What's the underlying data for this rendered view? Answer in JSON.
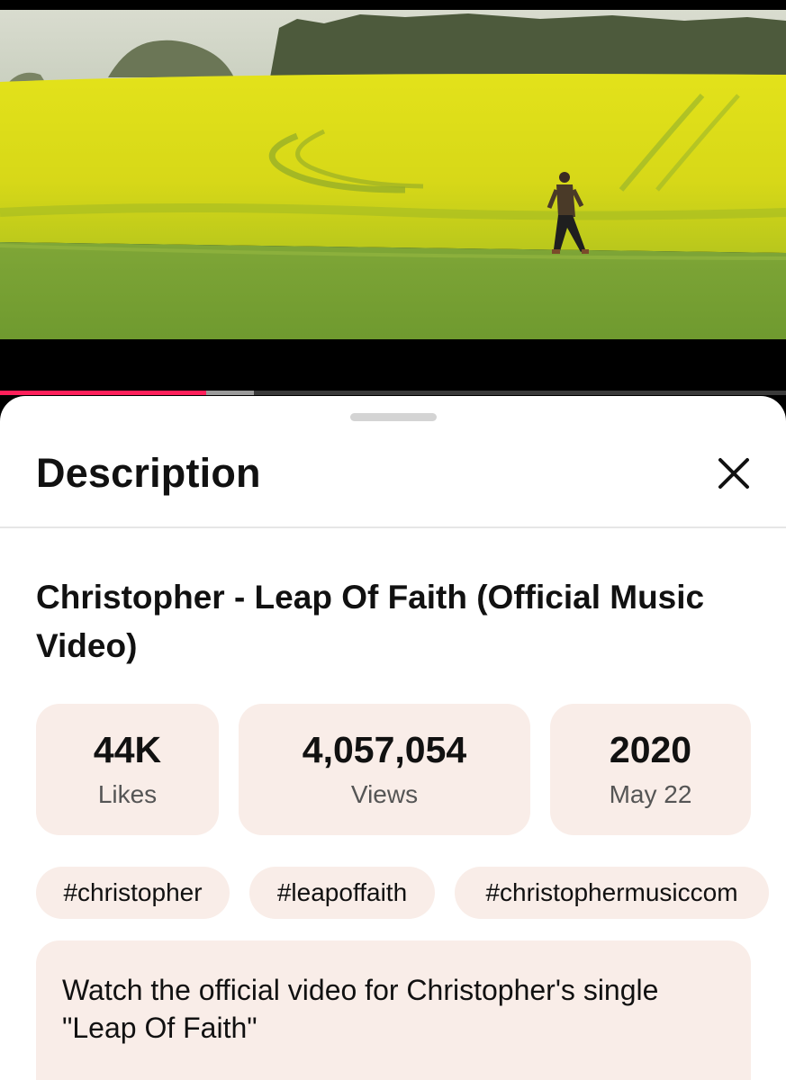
{
  "player": {
    "progress_played_fraction": 0.262,
    "progress_buffered_fraction": 0.323
  },
  "sheet": {
    "title": "Description",
    "close_icon": "close-icon"
  },
  "video": {
    "title": "Christopher - Leap Of Faith (Official Music Video)"
  },
  "stats": [
    {
      "value": "44K",
      "label": "Likes"
    },
    {
      "value": "4,057,054",
      "label": "Views"
    },
    {
      "value": "2020",
      "label": "May 22"
    }
  ],
  "hashtags": [
    "#christopher",
    "#leapoffaith",
    "#christophermusiccom"
  ],
  "description": {
    "text": "Watch the official video for Christopher's single \"Leap Of Faith\""
  }
}
